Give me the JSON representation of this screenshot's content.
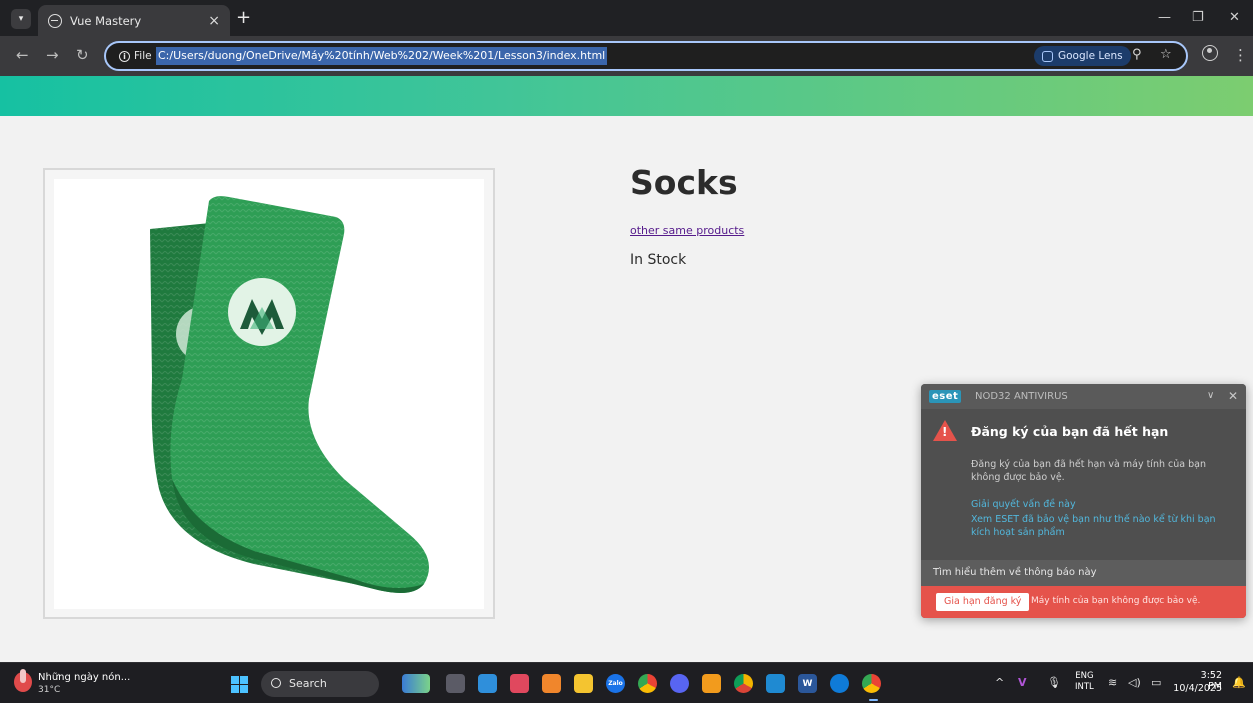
{
  "browser": {
    "tab_title": "Vue Mastery",
    "tab_close": "×",
    "new_tab": "+",
    "site_info_label": "File",
    "url": "C:/Users/duong/OneDrive/Máy%20tính/Web%202/Week%201/Lesson3/index.html",
    "google_lens_label": "Google Lens"
  },
  "product": {
    "title": "Socks",
    "link_text": "other same products",
    "stock_status": "In Stock",
    "sock_color": "#2e9e55"
  },
  "eset": {
    "logo": "eset",
    "product_name": "NOD32 ANTIVIRUS",
    "title": "Đăng ký của bạn đã hết hạn",
    "body": "Đăng ký của bạn đã hết hạn và máy tính của bạn không được bảo vệ.",
    "link_resolve": "Giải quyết vấn đề này",
    "link_protection": "Xem ESET đã bảo vệ bạn như thế nào kể từ khi bạn kích hoạt sản phẩm",
    "learn_more": "Tìm hiểu thêm về thông báo này",
    "renew_button": "Gia hạn đăng ký",
    "footer_text": "Máy tính của bạn không được bảo vệ.",
    "accent_color": "#e5534b"
  },
  "taskbar": {
    "weather_title": "Những ngày nón...",
    "weather_temp": "31°C",
    "search_label": "Search",
    "language_line1": "ENG",
    "language_line2": "INTL",
    "time": "3:52 PM",
    "date": "10/4/2025",
    "apps": [
      "copilot",
      "task-view",
      "notepad",
      "microsoft-store",
      "files",
      "file-explorer",
      "zalo",
      "chrome",
      "discord",
      "app-orange",
      "chrome-canary",
      "vscode",
      "word",
      "edge",
      "chrome-active"
    ]
  }
}
